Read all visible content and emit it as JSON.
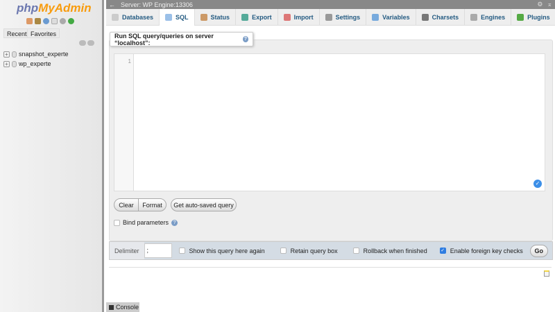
{
  "sidebar": {
    "logo_php": "php",
    "logo_myadmin": "MyAdmin",
    "tabs": [
      "Recent",
      "Favorites"
    ],
    "databases": [
      "snapshot_experte",
      "wp_experte"
    ]
  },
  "topbar": {
    "server": "Server: WP Engine:13306"
  },
  "tabs": [
    {
      "label": "Databases",
      "color": "#bbb"
    },
    {
      "label": "SQL",
      "color": "#6b9bd1"
    },
    {
      "label": "Status",
      "color": "#c96"
    },
    {
      "label": "Export",
      "color": "#5a9"
    },
    {
      "label": "Import",
      "color": "#d77"
    },
    {
      "label": "Settings",
      "color": "#999"
    },
    {
      "label": "Variables",
      "color": "#7ad"
    },
    {
      "label": "Charsets",
      "color": "#777"
    },
    {
      "label": "Engines",
      "color": "#aaa"
    },
    {
      "label": "Plugins",
      "color": "#5a4"
    }
  ],
  "main": {
    "legend": "Run SQL query/queries on server “localhost”:",
    "line_number": "1",
    "query": "",
    "buttons": {
      "clear": "Clear",
      "format": "Format",
      "autosaved": "Get auto-saved query"
    },
    "bind_parameters": "Bind parameters",
    "delimiter_label": "Delimiter",
    "delimiter_value": ";",
    "options": [
      {
        "label": "Show this query here again",
        "checked": false
      },
      {
        "label": "Retain query box",
        "checked": false
      },
      {
        "label": "Rollback when finished",
        "checked": false
      },
      {
        "label": "Enable foreign key checks",
        "checked": true
      }
    ],
    "go": "Go"
  },
  "console": "Console"
}
